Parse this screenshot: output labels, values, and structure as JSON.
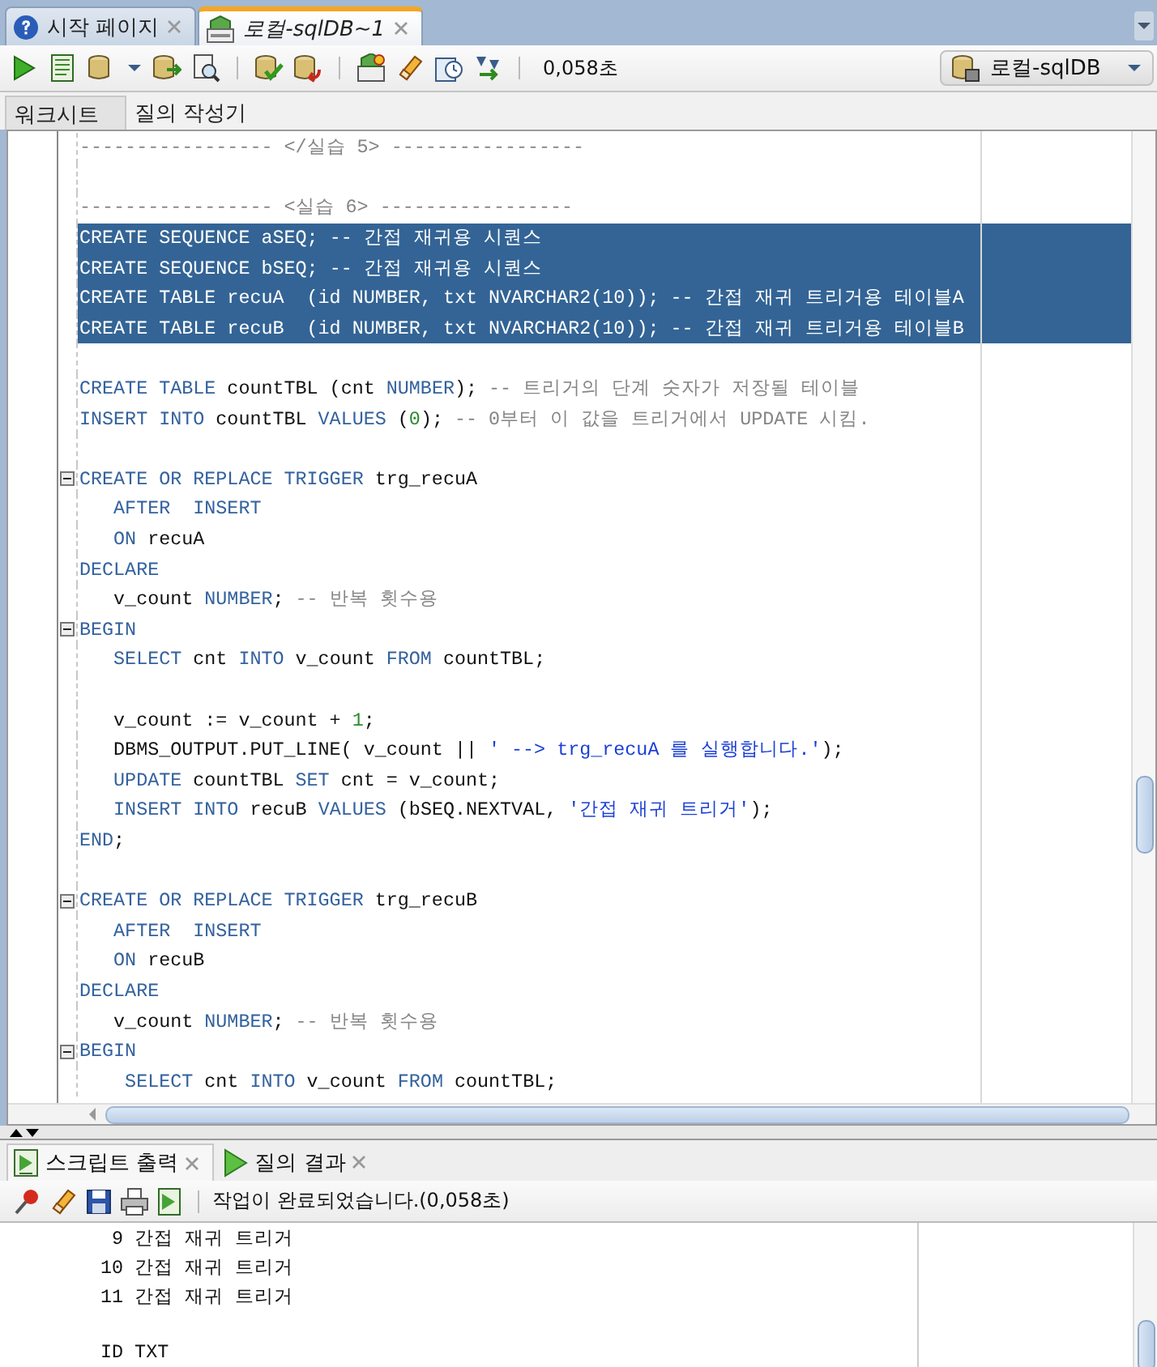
{
  "document_tabs": [
    {
      "label": "시작 페이지",
      "selected": false
    },
    {
      "label": "로컬-sqlDB~1",
      "selected": true
    }
  ],
  "toolbar": {
    "elapsed": "0,058초",
    "connection": "로컬-sqlDB"
  },
  "sub_tabs": [
    {
      "label": "워크시트",
      "selected": true
    },
    {
      "label": "질의 작성기",
      "selected": false
    }
  ],
  "editor": {
    "lines": [
      {
        "selected": false,
        "fold_marker": false,
        "tokens": [
          {
            "kind": "cm",
            "text": "----------------- </실습 5> -----------------"
          }
        ]
      },
      {
        "selected": false,
        "fold_marker": false
      },
      {
        "selected": false,
        "fold_marker": false,
        "tokens": [
          {
            "kind": "cm",
            "text": "----------------- <실습 6> -----------------"
          }
        ]
      },
      {
        "selected": true,
        "fold_marker": false,
        "tokens": [
          {
            "kind": "kw",
            "text": "CREATE SEQUENCE"
          },
          {
            "kind": "id",
            "text": " aSEQ; "
          },
          {
            "kind": "cm",
            "text": "-- 간접 재귀용 시퀀스"
          }
        ]
      },
      {
        "selected": true,
        "fold_marker": false,
        "tokens": [
          {
            "kind": "kw",
            "text": "CREATE SEQUENCE"
          },
          {
            "kind": "id",
            "text": " bSEQ; "
          },
          {
            "kind": "cm",
            "text": "-- 간접 재귀용 시퀀스"
          }
        ]
      },
      {
        "selected": true,
        "fold_marker": false,
        "tokens": [
          {
            "kind": "kw",
            "text": "CREATE TABLE"
          },
          {
            "kind": "id",
            "text": " recuA  (id "
          },
          {
            "kind": "kw",
            "text": "NUMBER"
          },
          {
            "kind": "id",
            "text": ", txt "
          },
          {
            "kind": "kw",
            "text": "NVARCHAR2"
          },
          {
            "kind": "id",
            "text": "("
          },
          {
            "kind": "num",
            "text": "10"
          },
          {
            "kind": "id",
            "text": ")); "
          },
          {
            "kind": "cm",
            "text": "-- 간접 재귀 트리거용 테이블A"
          }
        ]
      },
      {
        "selected": true,
        "fold_marker": false,
        "tokens": [
          {
            "kind": "kw",
            "text": "CREATE TABLE"
          },
          {
            "kind": "id",
            "text": " recuB  (id "
          },
          {
            "kind": "kw",
            "text": "NUMBER"
          },
          {
            "kind": "id",
            "text": ", txt "
          },
          {
            "kind": "kw",
            "text": "NVARCHAR2"
          },
          {
            "kind": "id",
            "text": "("
          },
          {
            "kind": "num",
            "text": "10"
          },
          {
            "kind": "id",
            "text": ")); "
          },
          {
            "kind": "cm",
            "text": "-- 간접 재귀 트리거용 테이블B"
          }
        ]
      },
      {
        "selected": false,
        "fold_marker": false
      },
      {
        "selected": false,
        "fold_marker": false,
        "tokens": [
          {
            "kind": "kw",
            "text": "CREATE TABLE"
          },
          {
            "kind": "id",
            "text": " countTBL (cnt "
          },
          {
            "kind": "kw",
            "text": "NUMBER"
          },
          {
            "kind": "id",
            "text": "); "
          },
          {
            "kind": "cm",
            "text": "-- 트리거의 단계 숫자가 저장될 테이블"
          }
        ]
      },
      {
        "selected": false,
        "fold_marker": false,
        "tokens": [
          {
            "kind": "kw",
            "text": "INSERT INTO"
          },
          {
            "kind": "id",
            "text": " countTBL "
          },
          {
            "kind": "kw",
            "text": "VALUES"
          },
          {
            "kind": "id",
            "text": " ("
          },
          {
            "kind": "num",
            "text": "0"
          },
          {
            "kind": "id",
            "text": "); "
          },
          {
            "kind": "cm",
            "text": "-- 0부터 이 값을 트리거에서 UPDATE 시킴."
          }
        ]
      },
      {
        "selected": false,
        "fold_marker": false
      },
      {
        "selected": false,
        "fold_marker": true,
        "tokens": [
          {
            "kind": "kw",
            "text": "CREATE OR REPLACE TRIGGER"
          },
          {
            "kind": "id",
            "text": " trg_recuA"
          }
        ]
      },
      {
        "selected": false,
        "fold_marker": false,
        "tokens": [
          {
            "kind": "kw",
            "text": "   AFTER  INSERT"
          }
        ]
      },
      {
        "selected": false,
        "fold_marker": false,
        "tokens": [
          {
            "kind": "kw",
            "text": "   ON"
          },
          {
            "kind": "id",
            "text": " recuA"
          }
        ]
      },
      {
        "selected": false,
        "fold_marker": false,
        "tokens": [
          {
            "kind": "kw",
            "text": "DECLARE"
          }
        ]
      },
      {
        "selected": false,
        "fold_marker": false,
        "tokens": [
          {
            "kind": "id",
            "text": "   v_count "
          },
          {
            "kind": "kw",
            "text": "NUMBER"
          },
          {
            "kind": "id",
            "text": "; "
          },
          {
            "kind": "cm",
            "text": "-- 반복 횟수용"
          }
        ]
      },
      {
        "selected": false,
        "fold_marker": true,
        "tokens": [
          {
            "kind": "kw",
            "text": "BEGIN"
          }
        ]
      },
      {
        "selected": false,
        "fold_marker": false,
        "tokens": [
          {
            "kind": "kw",
            "text": "   SELECT"
          },
          {
            "kind": "id",
            "text": " cnt "
          },
          {
            "kind": "kw",
            "text": "INTO"
          },
          {
            "kind": "id",
            "text": " v_count "
          },
          {
            "kind": "kw",
            "text": "FROM"
          },
          {
            "kind": "id",
            "text": " countTBL;"
          }
        ]
      },
      {
        "selected": false,
        "fold_marker": false
      },
      {
        "selected": false,
        "fold_marker": false,
        "tokens": [
          {
            "kind": "id",
            "text": "   v_count := v_count + "
          },
          {
            "kind": "num",
            "text": "1"
          },
          {
            "kind": "id",
            "text": ";"
          }
        ]
      },
      {
        "selected": false,
        "fold_marker": false,
        "tokens": [
          {
            "kind": "id",
            "text": "   DBMS_OUTPUT.PUT_LINE( v_count || "
          },
          {
            "kind": "str",
            "text": "' --> trg_recuA 를 실행합니다.'"
          },
          {
            "kind": "id",
            "text": ");"
          }
        ]
      },
      {
        "selected": false,
        "fold_marker": false,
        "tokens": [
          {
            "kind": "kw",
            "text": "   UPDATE"
          },
          {
            "kind": "id",
            "text": " countTBL "
          },
          {
            "kind": "kw",
            "text": "SET"
          },
          {
            "kind": "id",
            "text": " cnt = v_count;"
          }
        ]
      },
      {
        "selected": false,
        "fold_marker": false,
        "tokens": [
          {
            "kind": "kw",
            "text": "   INSERT INTO"
          },
          {
            "kind": "id",
            "text": " recuB "
          },
          {
            "kind": "kw",
            "text": "VALUES"
          },
          {
            "kind": "id",
            "text": " (bSEQ.NEXTVAL, "
          },
          {
            "kind": "str",
            "text": "'간접 재귀 트리거'"
          },
          {
            "kind": "id",
            "text": ");"
          }
        ]
      },
      {
        "selected": false,
        "fold_marker": false,
        "tokens": [
          {
            "kind": "kw",
            "text": "END"
          },
          {
            "kind": "id",
            "text": ";"
          }
        ]
      },
      {
        "selected": false,
        "fold_marker": false
      },
      {
        "selected": false,
        "fold_marker": true,
        "tokens": [
          {
            "kind": "kw",
            "text": "CREATE OR REPLACE TRIGGER"
          },
          {
            "kind": "id",
            "text": " trg_recuB"
          }
        ]
      },
      {
        "selected": false,
        "fold_marker": false,
        "tokens": [
          {
            "kind": "kw",
            "text": "   AFTER  INSERT"
          }
        ]
      },
      {
        "selected": false,
        "fold_marker": false,
        "tokens": [
          {
            "kind": "kw",
            "text": "   ON"
          },
          {
            "kind": "id",
            "text": " recuB"
          }
        ]
      },
      {
        "selected": false,
        "fold_marker": false,
        "tokens": [
          {
            "kind": "kw",
            "text": "DECLARE"
          }
        ]
      },
      {
        "selected": false,
        "fold_marker": false,
        "tokens": [
          {
            "kind": "id",
            "text": "   v_count "
          },
          {
            "kind": "kw",
            "text": "NUMBER"
          },
          {
            "kind": "id",
            "text": "; "
          },
          {
            "kind": "cm",
            "text": "-- 반복 횟수용"
          }
        ]
      },
      {
        "selected": false,
        "fold_marker": true,
        "tokens": [
          {
            "kind": "kw",
            "text": "BEGIN"
          }
        ]
      },
      {
        "selected": false,
        "fold_marker": false,
        "tokens": [
          {
            "kind": "kw",
            "text": "    SELECT"
          },
          {
            "kind": "id",
            "text": " cnt "
          },
          {
            "kind": "kw",
            "text": "INTO"
          },
          {
            "kind": "id",
            "text": " v_count "
          },
          {
            "kind": "kw",
            "text": "FROM"
          },
          {
            "kind": "id",
            "text": " countTBL;"
          }
        ]
      }
    ]
  },
  "output_tabs": [
    {
      "label": "스크립트 출력",
      "selected": true
    },
    {
      "label": "질의 결과",
      "selected": false
    }
  ],
  "output_toolbar": {
    "status": "작업이 완료되었습니다.(0,058초)"
  },
  "output": {
    "result_rows": [
      "  9 간접 재귀 트리거",
      " 10 간접 재귀 트리거",
      " 11 간접 재귀 트리거"
    ],
    "next_header": " ID TXT"
  }
}
